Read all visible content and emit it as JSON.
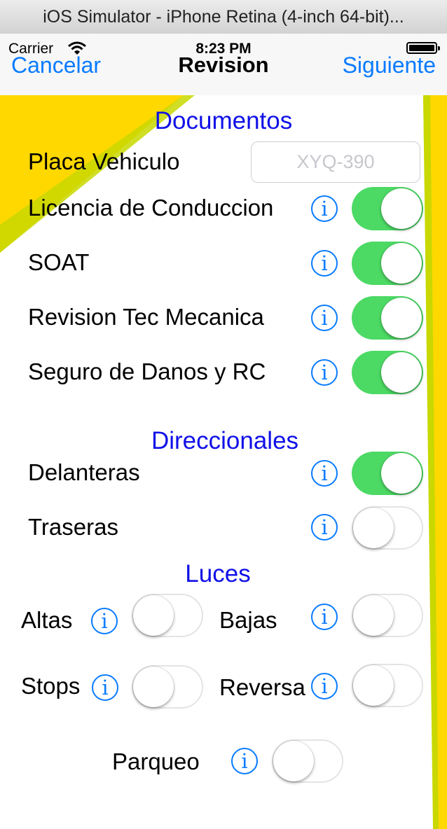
{
  "window": {
    "title": "iOS Simulator - iPhone Retina (4-inch 64-bit)..."
  },
  "status_bar": {
    "carrier": "Carrier",
    "time": "8:23 PM"
  },
  "nav": {
    "left": "Cancelar",
    "title": "Revision",
    "right": "Siguiente"
  },
  "documentos": {
    "header": "Documentos",
    "placa_label": "Placa Vehiculo",
    "placa_placeholder": "XYQ-390",
    "items": [
      {
        "label": "Licencia de Conduccion",
        "on": true
      },
      {
        "label": "SOAT",
        "on": true
      },
      {
        "label": "Revision Tec Mecanica",
        "on": true
      },
      {
        "label": "Seguro de Danos y RC",
        "on": true
      }
    ]
  },
  "direccionales": {
    "header": "Direccionales",
    "items": [
      {
        "label": "Delanteras",
        "on": true
      },
      {
        "label": "Traseras",
        "on": false
      }
    ]
  },
  "luces": {
    "header": "Luces",
    "items": [
      {
        "label": "Altas",
        "on": false
      },
      {
        "label": "Bajas",
        "on": false
      },
      {
        "label": "Stops",
        "on": false
      },
      {
        "label": "Reversa",
        "on": false
      },
      {
        "label": "Parqueo",
        "on": false
      }
    ]
  },
  "info_glyph": "i",
  "colors": {
    "accent": "#0a7bff",
    "switch_on": "#4cd964",
    "section_header": "#1010e8",
    "background_yellow": "#ffd800"
  }
}
